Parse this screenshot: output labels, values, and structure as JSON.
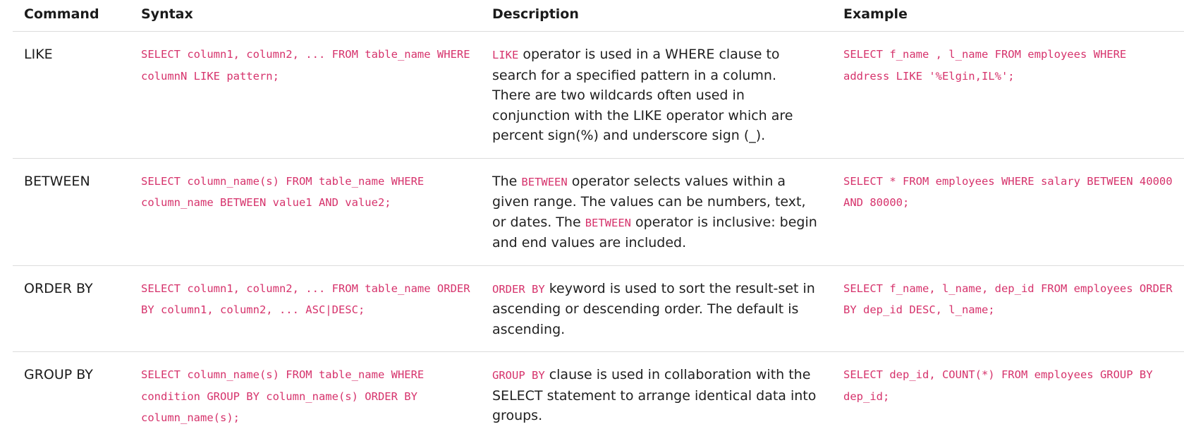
{
  "table": {
    "headers": {
      "command": "Command",
      "syntax": "Syntax",
      "description": "Description",
      "example": "Example"
    },
    "rows": [
      {
        "command": "LIKE",
        "syntax": "SELECT column1, column2, ... FROM table_name WHERE columnN LIKE pattern;",
        "description_keyword": "LIKE",
        "description_text": " operator is used in a WHERE clause to search for a specified pattern in a column.",
        "description_extra": "There are two wildcards often used in conjunction with the LIKE operator which are percent sign(%) and underscore sign (_).",
        "example": "SELECT f_name , l_name FROM employees WHERE address LIKE '%Elgin,IL%';"
      },
      {
        "command": "BETWEEN",
        "syntax": "SELECT column_name(s) FROM table_name WHERE column_name BETWEEN value1 AND value2;",
        "description_prefix": "The ",
        "description_keyword": "BETWEEN",
        "description_text": " operator selects values within a given range. The values can be numbers, text, or dates. The ",
        "description_keyword2": "BETWEEN",
        "description_text2": " operator is inclusive: begin and end values are included.",
        "example": "SELECT * FROM employees WHERE salary BETWEEN 40000 AND 80000;"
      },
      {
        "command": "ORDER BY",
        "syntax": "SELECT column1, column2, ... FROM table_name ORDER BY column1, column2, ... ASC|DESC;",
        "description_keyword": "ORDER BY",
        "description_text": " keyword is used to sort the result-set in ascending or descending order. The default is ascending.",
        "example": "SELECT f_name, l_name, dep_id FROM employees ORDER BY dep_id DESC, l_name;"
      },
      {
        "command": "GROUP BY",
        "syntax": "SELECT column_name(s) FROM table_name WHERE condition GROUP BY column_name(s) ORDER BY column_name(s);",
        "description_keyword": "GROUP BY",
        "description_text": " clause is used in collaboration with the SELECT statement to arrange identical data into groups.",
        "example": "SELECT dep_id, COUNT(*) FROM employees GROUP BY dep_id;"
      }
    ]
  },
  "colors": {
    "code": "#d6336c",
    "text": "#1f1f1f",
    "divider": "#dcdcdc"
  }
}
